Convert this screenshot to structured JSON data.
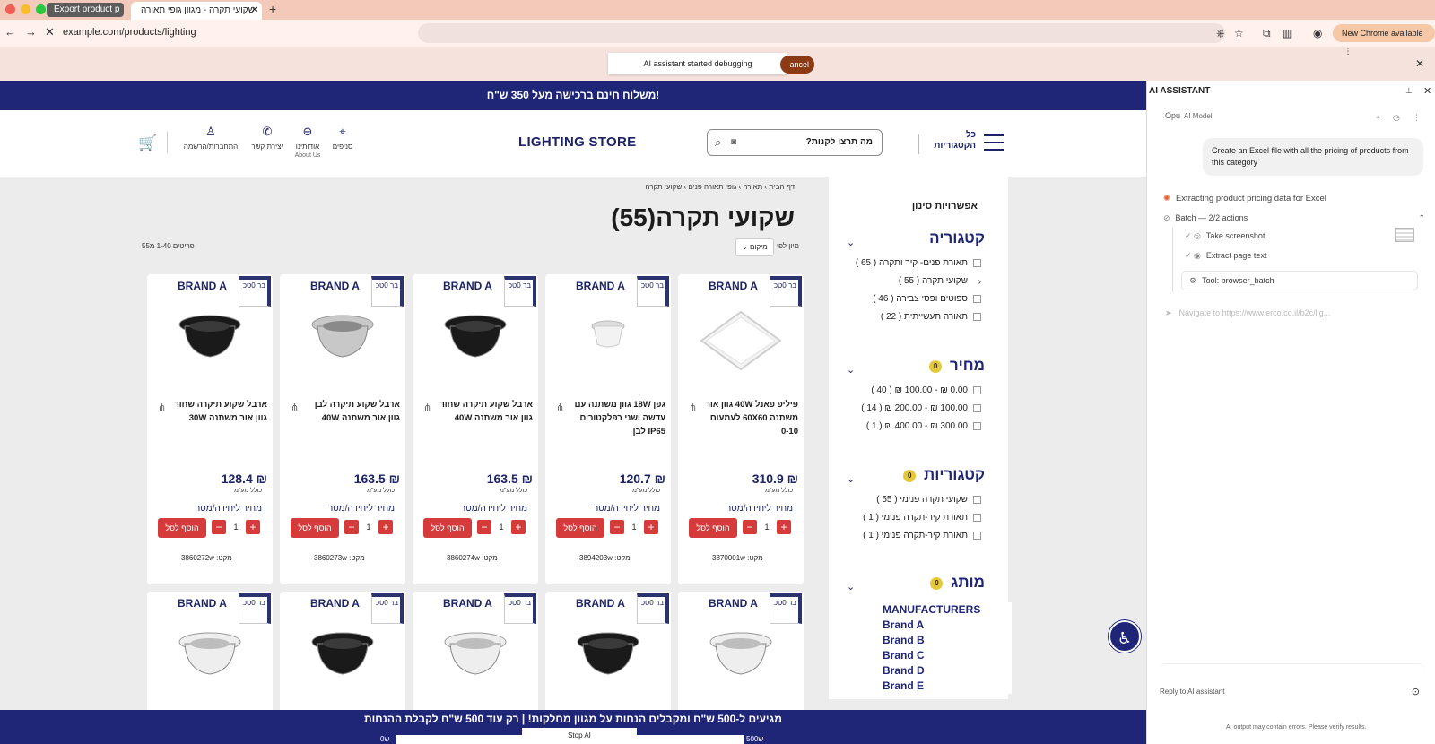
{
  "browser": {
    "tabs": [
      {
        "label": "Export product p"
      },
      {
        "label": "שקועי תקרה - מגוון גופי תאורה"
      }
    ],
    "url": "example.com/products/lighting",
    "new_chrome": "New Chrome available"
  },
  "debug": {
    "toast": "AI assistant started debugging",
    "cancel": "ancel"
  },
  "store": {
    "banner": "משלוח חינם ברכישה מעל 350 ש\"ח!",
    "logo": "LIGHTING STORE",
    "search_placeholder": "מה תרצו לקנות?",
    "all_categories": "כל הקטגוריות",
    "nav": [
      {
        "label": "סניפים",
        "sub": ""
      },
      {
        "label": "אודותינו",
        "sub": "About Us"
      },
      {
        "label": "יצירת קשר",
        "sub": ""
      },
      {
        "label": "התחברות/הרשמה",
        "sub": ""
      }
    ],
    "breadcrumb": "דף הבית  ›  תאורה  ›  גופי תאורה פנים  ›  שקועי תקרה",
    "page_title": "שקועי תקרה(55)",
    "results_count": "פריטים 1-40 מ55",
    "sort_label": "מיון לפי",
    "sort_value": "מיקום",
    "bottom_banner": "מגיעים ל-500 ש\"ח ומקבלים הנחות על מגוון מחלקות! | רק עוד 500 ש\"ח לקבלת ההנחות",
    "bottom_left": "0ש",
    "bottom_right": "500ש",
    "stop_ai": "Stop AI"
  },
  "filters": {
    "heading": "אפשרויות סינון",
    "sections": [
      {
        "title": "קטגוריה",
        "badge": "",
        "items": [
          "תאורת פנים- קיר ותקרה ( 65 )",
          "שקועי תקרה ( 55 )",
          "ספוטים ופסי צבירה ( 46 )",
          "תאורה תעשייתית ( 22 )"
        ]
      },
      {
        "title": "מחיר",
        "badge": "0",
        "items": [
          "0.00 ₪ - 100.00 ₪ ( 40 )",
          "100.00 ₪ - 200.00 ₪ ( 14 )",
          "300.00 ₪ - 400.00 ₪ ( 1 )"
        ]
      },
      {
        "title": "קטגוריות",
        "badge": "0",
        "items": [
          "שקועי תקרה פנימי ( 55 )",
          "תאורת קיר-תקרה פנימי ( 1 )",
          "תאורת קיר-תקרה פנימי ( 1 )"
        ]
      },
      {
        "title": "מותג",
        "badge": "0",
        "items": []
      }
    ],
    "manufacturers": {
      "title": "MANUFACTURERS",
      "items": [
        "Brand A",
        "Brand B",
        "Brand C",
        "Brand D",
        "Brand E"
      ]
    }
  },
  "product_common": {
    "brand": "BRAND A",
    "corner": "בר 0טכ",
    "incl_vat": "כולל מע\"מ",
    "unit_price": "מחיר ליחידה/מטר",
    "add_to_cart": "הוסף לסל",
    "qty": "1",
    "sku_prefix": "מקט:"
  },
  "products": [
    {
      "name": "פיליפ פאנל 40W גוון אור משתנה 60X60 לעמעום 0-10",
      "price": "310.9 ₪",
      "sku": "3870001w",
      "lamp": "panel"
    },
    {
      "name": "גפן 18W גוון משתנה עם עדשה ושני רפלקטורים IP65 לבן",
      "price": "120.7 ₪",
      "sku": "3894203w",
      "lamp": "small"
    },
    {
      "name": "ארבל שקוע תיקרה שחור גוון אור משתנה 40W",
      "price": "163.5 ₪",
      "sku": "3860274w",
      "lamp": "black"
    },
    {
      "name": "ארבל שקוע תיקרה לבן גוון אור משתנה 40W",
      "price": "163.5 ₪",
      "sku": "3860273w",
      "lamp": "silver"
    },
    {
      "name": "ארבל שקוע תיקרה שחור גוון אור משתנה 30W",
      "price": "128.4 ₪",
      "sku": "3860272w",
      "lamp": "black"
    }
  ],
  "row2_lamps": [
    "white",
    "black",
    "white",
    "black",
    "white"
  ],
  "ai": {
    "title": "AI ASSISTANT",
    "model_short": "Opu",
    "model_label": "AI Model",
    "user_message": "Create an Excel file with all the pricing of products from this category",
    "status": "Extracting product pricing data for Excel",
    "batch": "Batch — 2/2 actions",
    "steps": [
      "Take screenshot",
      "Extract page text"
    ],
    "tool": "Tool: browser_batch",
    "navigate": "Navigate to https://www.erco.co.il/b2c/lig...",
    "reply_placeholder": "Reply to AI assistant",
    "disclaimer": "AI output may contain errors. Please verify results."
  }
}
